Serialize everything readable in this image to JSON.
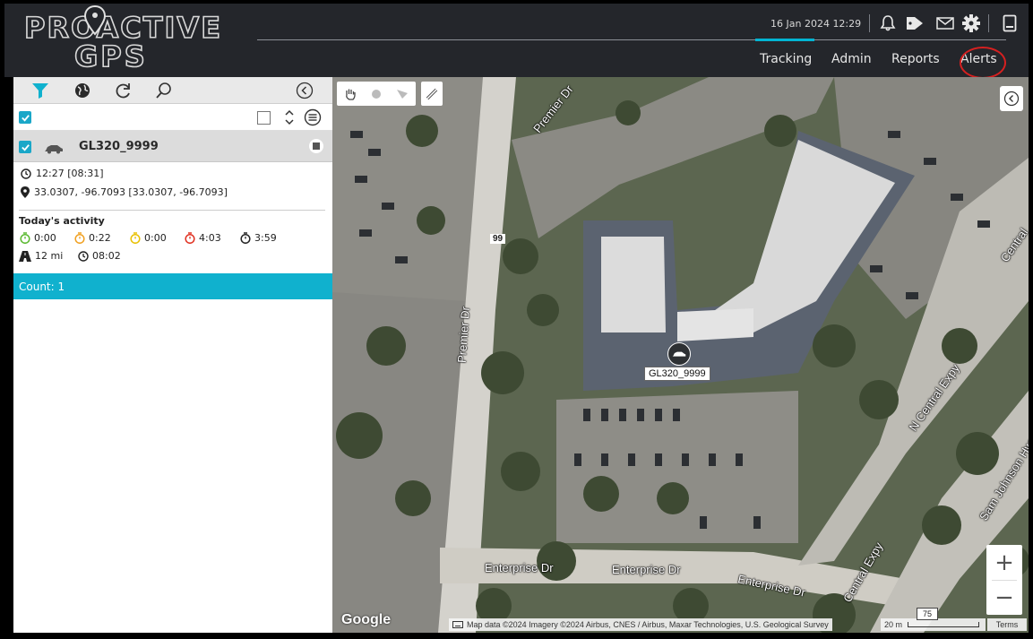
{
  "header": {
    "logo_top": "PROACTIVE",
    "logo_bottom": "GPS",
    "datetime": "16 Jan 2024 12:29",
    "nav": [
      "Tracking",
      "Admin",
      "Reports",
      "Alerts"
    ],
    "active_nav": "Tracking",
    "icons": [
      "bell-icon",
      "tag-icon",
      "mail-icon",
      "gear-icon",
      "device-icon"
    ],
    "accent_color": "#00b4d2",
    "highlight_color": "#d62020"
  },
  "sidebar": {
    "toolbar_icons": [
      "filter-icon",
      "globe-icon",
      "refresh-icon",
      "search-icon",
      "collapse-icon"
    ],
    "vehicle": {
      "name": "GL320_9999",
      "time": "12:27 [08:31]",
      "location": "33.0307, -96.7093 [33.0307, -96.7093]"
    },
    "activity": {
      "title": "Today's activity",
      "timers": [
        {
          "value": "0:00",
          "color": "#59b82f"
        },
        {
          "value": "0:22",
          "color": "#f0a020"
        },
        {
          "value": "0:00",
          "color": "#e8c000"
        },
        {
          "value": "4:03",
          "color": "#e03020"
        },
        {
          "value": "3:59",
          "color": "#222222"
        }
      ],
      "distance": "12 mi",
      "duration": "08:02"
    },
    "count": "Count: 1",
    "count_color": "#10b1ce"
  },
  "map": {
    "marker_label": "GL320_9999",
    "streets": {
      "premier_top": "Premier Dr",
      "premier_mid": "Premier Dr",
      "enterprise_1": "Enterprise Dr",
      "enterprise_2": "Enterprise Dr",
      "enterprise_3": "Enterprise Dr",
      "central_top": "Central",
      "central_n": "N Central Expy",
      "central_low": "Central Expy",
      "sam_johnson": "Sam Johnson Hwy"
    },
    "route_shield": "99",
    "highway_shield": "75",
    "google": "Google",
    "attribution": "Map data ©2024 Imagery ©2024 Airbus, CNES / Airbus, Maxar Technologies, U.S. Geological Survey",
    "scale": "20 m",
    "terms": "Terms",
    "zoom_in": "+",
    "zoom_out": "−"
  }
}
